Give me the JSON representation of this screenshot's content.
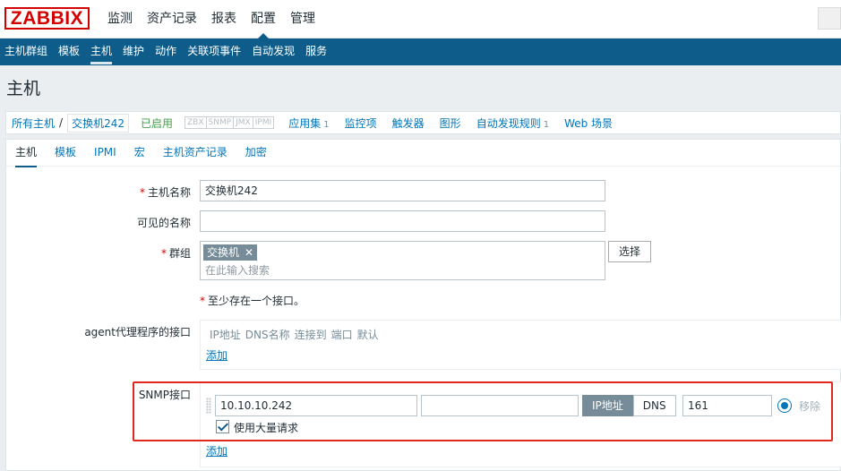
{
  "logo": "ZABBIX",
  "main_menu": [
    {
      "label": "监测",
      "active": false
    },
    {
      "label": "资产记录",
      "active": false
    },
    {
      "label": "报表",
      "active": false
    },
    {
      "label": "配置",
      "active": true
    },
    {
      "label": "管理",
      "active": false
    }
  ],
  "sub_menu": [
    {
      "label": "主机群组",
      "active": false
    },
    {
      "label": "模板",
      "active": false
    },
    {
      "label": "主机",
      "active": true
    },
    {
      "label": "维护",
      "active": false
    },
    {
      "label": "动作",
      "active": false
    },
    {
      "label": "关联项事件",
      "active": false
    },
    {
      "label": "自动发现",
      "active": false
    },
    {
      "label": "服务",
      "active": false
    }
  ],
  "page_title": "主机",
  "host_nav": {
    "all_hosts": "所有主机",
    "separator": "/",
    "current_host": "交换机242",
    "status": "已启用",
    "availability": [
      "ZBX",
      "SNMP",
      "JMX",
      "IPMI"
    ],
    "items": [
      {
        "label": "应用集",
        "count": "1"
      },
      {
        "label": "监控项",
        "count": ""
      },
      {
        "label": "触发器",
        "count": ""
      },
      {
        "label": "图形",
        "count": ""
      },
      {
        "label": "自动发现规则",
        "count": "1"
      },
      {
        "label": "Web 场景",
        "count": ""
      }
    ]
  },
  "tabs": [
    {
      "label": "主机",
      "active": true
    },
    {
      "label": "模板",
      "active": false
    },
    {
      "label": "IPMI",
      "active": false
    },
    {
      "label": "宏",
      "active": false
    },
    {
      "label": "主机资产记录",
      "active": false
    },
    {
      "label": "加密",
      "active": false
    }
  ],
  "form": {
    "host_name_label": "主机名称",
    "host_name_value": "交换机242",
    "visible_name_label": "可见的名称",
    "visible_name_value": "",
    "groups_label": "群组",
    "group_chip": "交换机",
    "group_chip_remove": "✕",
    "groups_placeholder": "在此输入搜索",
    "select_button": "选择",
    "required_marker": "*",
    "interface_note": "至少存在一个接口。",
    "agent_label": "agent代理程序的接口",
    "interface_headers": [
      "IP地址",
      "DNS名称",
      "连接到",
      "端口",
      "默认"
    ],
    "add_link": "添加",
    "snmp_label": "SNMP接口",
    "snmp": {
      "ip": "10.10.10.242",
      "dns": "",
      "connect_ip": "IP地址",
      "connect_dns": "DNS",
      "port": "161",
      "remove": "移除",
      "bulk_label": "使用大量请求",
      "bulk_checked": true
    },
    "add_link2": "添加"
  },
  "colors": {
    "brand_red": "#d40000",
    "nav_blue": "#0e5c8a",
    "link_blue": "#0275b8",
    "enabled_green": "#429e47",
    "highlight_frame": "#e0281e"
  }
}
